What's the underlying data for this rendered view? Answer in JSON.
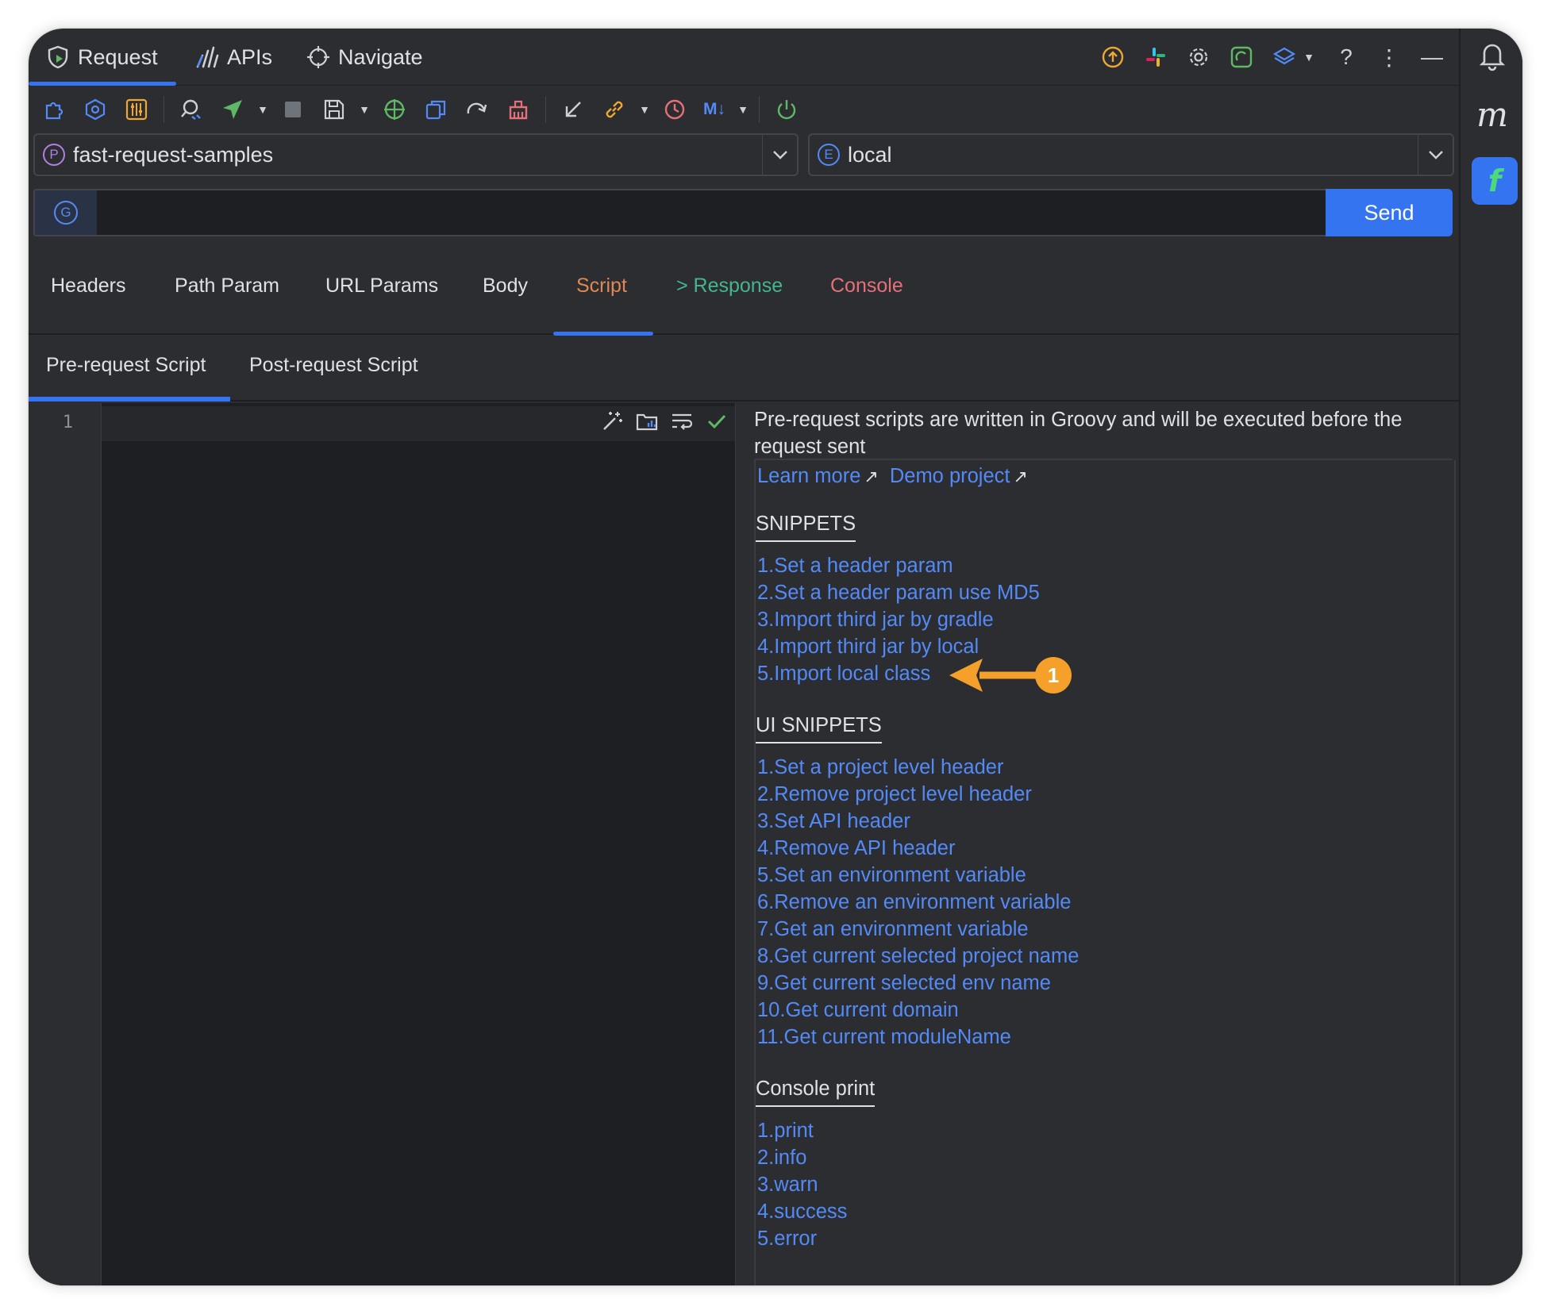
{
  "top_tabs": [
    {
      "label": "Request",
      "icon": "request-shield-icon"
    },
    {
      "label": "APIs",
      "icon": "apis-chart-icon"
    },
    {
      "label": "Navigate",
      "icon": "navigate-crosshair-icon"
    }
  ],
  "top_right_icons": [
    "upload-icon",
    "slack-icon",
    "gear-icon",
    "refresh-window-icon",
    "layers-icon",
    "help-icon",
    "more-vertical-icon",
    "minimize-icon"
  ],
  "toolbar_icons": [
    "plugin-icon",
    "hexagon-settings-icon",
    "sliders-icon",
    "search-api-icon",
    "send-icon",
    "stop-icon",
    "save-icon",
    "target-icon",
    "copy-icon",
    "redo-icon",
    "clear-icon",
    "import-icon",
    "link-icon",
    "history-icon",
    "markdown-icon",
    "power-icon"
  ],
  "project": {
    "badge": "P",
    "value": "fast-request-samples"
  },
  "environment": {
    "badge": "E",
    "value": "local"
  },
  "url": {
    "method_badge": "G",
    "value": "",
    "placeholder": ""
  },
  "send_label": "Send",
  "request_tabs": [
    {
      "label": "Headers",
      "color": "#dfe1e5"
    },
    {
      "label": "Path Param",
      "color": "#dfe1e5"
    },
    {
      "label": "URL Params",
      "color": "#dfe1e5"
    },
    {
      "label": "Body",
      "color": "#dfe1e5"
    },
    {
      "label": "Script",
      "color": "#e08855"
    },
    {
      "label": "> Response",
      "color": "#45b58f"
    },
    {
      "label": "Console",
      "color": "#e5707a"
    }
  ],
  "script_tabs": [
    "Pre-request Script",
    "Post-request Script"
  ],
  "editor": {
    "line_numbers": [
      "1"
    ]
  },
  "docs": {
    "description": "Pre-request scripts are written in Groovy and will be executed before the request sent",
    "learn_more": "Learn more",
    "demo_project": "Demo project",
    "arrow": "↗",
    "snippets_title": "SNIPPETS",
    "snippets": [
      "1.Set a header param",
      "2.Set a header param use MD5",
      "3.Import third jar by gradle",
      "4.Import third jar by local",
      "5.Import local class"
    ],
    "ui_snippets_title": "UI SNIPPETS",
    "ui_snippets": [
      "1.Set a project level header",
      "2.Remove project level header",
      "3.Set API header",
      "4.Remove API header",
      "5.Set an environment variable",
      "6.Remove an environment variable",
      "7.Get an environment variable",
      "8.Get current selected project name",
      "9.Get current selected env name",
      "10.Get current domain",
      "11.Get current moduleName"
    ],
    "console_title": "Console print",
    "console": [
      "1.print",
      "2.info",
      "3.warn",
      "4.success",
      "5.error"
    ]
  },
  "annotation": {
    "number": "1",
    "color": "#f5a02a"
  },
  "right_stripe": {
    "m_label": "m",
    "f_label": "f"
  },
  "colors": {
    "accent": "#3574f0",
    "link": "#548af7",
    "background": "#2b2d30",
    "editor": "#1e1f22"
  }
}
